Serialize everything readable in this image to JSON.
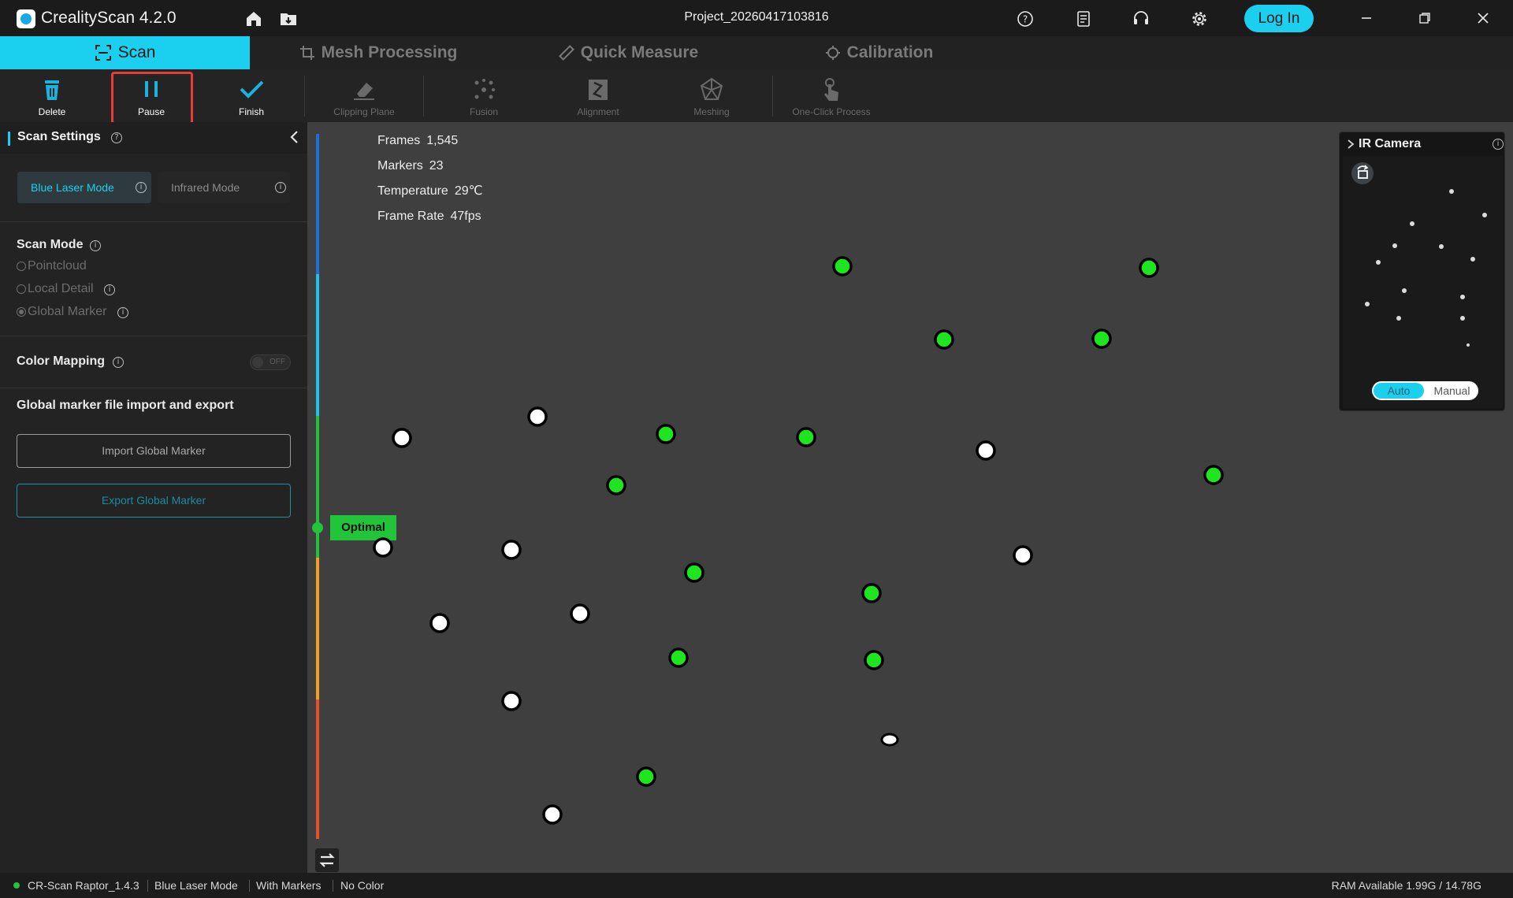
{
  "app": {
    "title": "CrealityScan 4.2.0",
    "project": "Project_20260417103816",
    "login_label": "Log In"
  },
  "tabs": [
    {
      "label": "Scan",
      "icon": "scan-frame-icon",
      "active": true
    },
    {
      "label": "Mesh Processing",
      "icon": "crop-icon",
      "active": false
    },
    {
      "label": "Quick Measure",
      "icon": "ruler-icon",
      "active": false
    },
    {
      "label": "Calibration",
      "icon": "target-icon",
      "active": false
    }
  ],
  "toolbar": {
    "delete": "Delete",
    "pause": "Pause",
    "finish": "Finish",
    "clipping_plane": "Clipping Plane",
    "fusion": "Fusion",
    "alignment": "Alignment",
    "meshing": "Meshing",
    "one_click": "One-Click Process"
  },
  "panel": {
    "title": "Scan Settings",
    "blue_laser": "Blue Laser Mode",
    "infrared": "Infrared Mode",
    "scan_mode_title": "Scan Mode",
    "scan_modes": [
      "Pointcloud",
      "Local Detail",
      "Global Marker"
    ],
    "selected_scan_mode": "Global Marker",
    "color_mapping": "Color Mapping",
    "color_mapping_state": "OFF",
    "marker_section": "Global marker file import and export",
    "import_label": "Import Global Marker",
    "export_label": "Export Global Marker"
  },
  "stats": {
    "frames_label": "Frames",
    "frames_value": "1,545",
    "markers_label": "Markers",
    "markers_value": "23",
    "temperature_label": "Temperature",
    "temperature_value": "29℃",
    "framerate_label": "Frame Rate",
    "framerate_value": "47fps"
  },
  "distance_indicator": {
    "label": "Optimal"
  },
  "ir_camera": {
    "title": "IR Camera",
    "auto": "Auto",
    "manual": "Manual"
  },
  "status": {
    "device": "CR-Scan Raptor_1.4.3",
    "mode": "Blue Laser Mode",
    "markers": "With Markers",
    "color": "No Color",
    "ram": "RAM Available 1.99G / 14.78G"
  },
  "colors": {
    "accent": "#1ad0ee",
    "tracked_marker": "#1ee61e",
    "untracked_marker": "#ffffff",
    "optimal": "#22c43a",
    "highlight": "#ea3b3b"
  }
}
